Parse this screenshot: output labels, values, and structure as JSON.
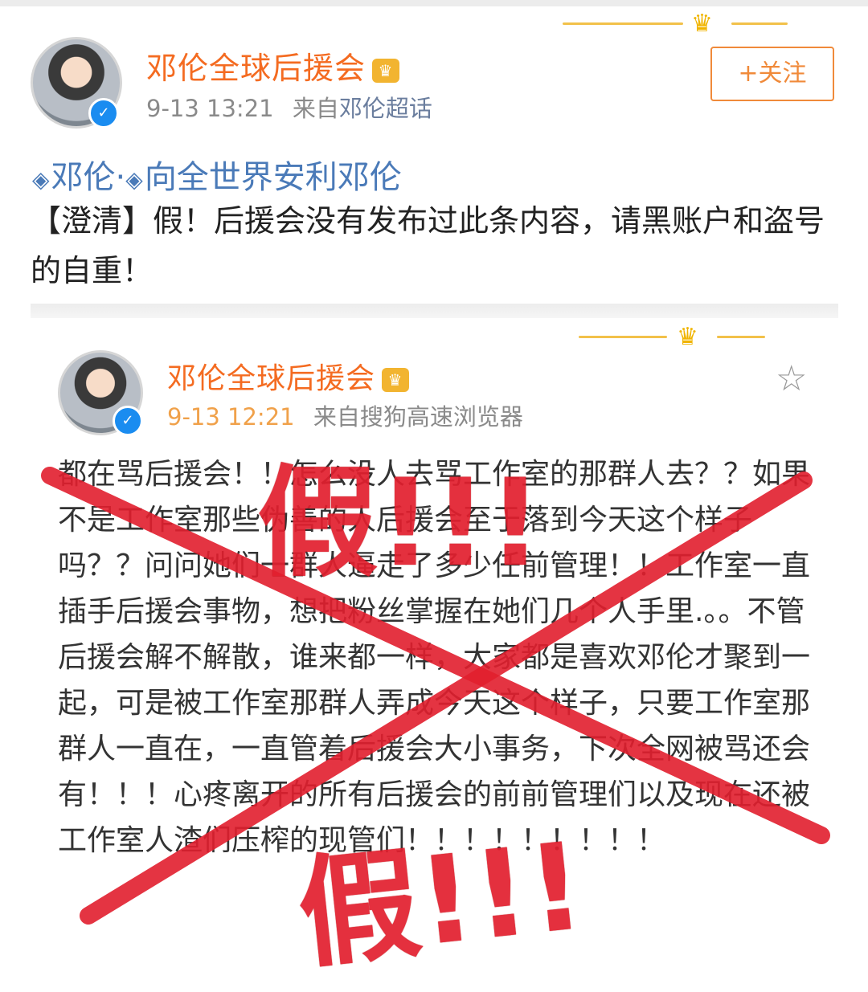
{
  "post": {
    "username": "邓伦全球后援会",
    "badge": "♛",
    "time": "9-13 13:21",
    "source_prefix": "来自",
    "source": "邓伦超话",
    "follow_label": "+关注",
    "topics": [
      "邓伦·",
      "向全世界安利邓伦"
    ],
    "text": "【澄清】假！后援会没有发布过此条内容，请黑账户和盗号的自重！"
  },
  "embedded": {
    "username": "邓伦全球后援会",
    "badge": "♛",
    "time": "9-13 12:21",
    "source": "来自搜狗高速浏览器",
    "text": "都在骂后援会！！怎么没人去骂工作室的那群人去？？如果不是工作室那些伪善的人后援会至于落到今天这个样子吗？？问问她们一群人逼走了多少任前管理！！工作室一直插手后援会事物，想把粉丝掌握在她们几个人手里.。。不管后援会解不解散，谁来都一样，大家都是喜欢邓伦才聚到一起，可是被工作室那群人弄成今天这个样子，只要工作室那群人一直在，一直管着后援会大小事务，下次全网被骂还会有！！！心疼离开的所有后援会的前前管理们以及现在还被工作室人渣们压榨的现管们！！！！！！！！！"
  },
  "stamp": {
    "text_top": "假!!!",
    "text_bottom": "假!!!"
  },
  "colors": {
    "username": "#f46b21",
    "topic": "#4a7ab8",
    "stamp": "#e21f2e",
    "verified": "#1a8cf0"
  }
}
